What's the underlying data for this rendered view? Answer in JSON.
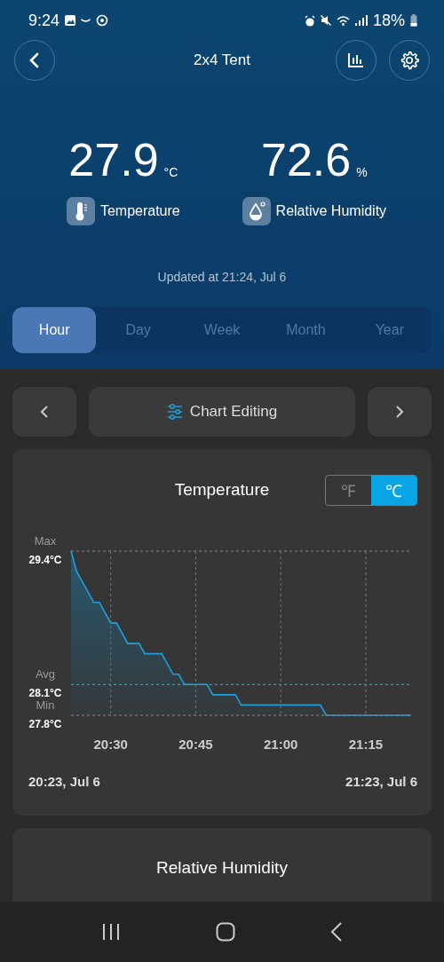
{
  "status_bar": {
    "time": "9:24",
    "battery": "18%"
  },
  "header": {
    "title": "2x4 Tent"
  },
  "readings": [
    {
      "kind": "temperature",
      "value": "27.9",
      "unit": "°C",
      "label": "Temperature"
    },
    {
      "kind": "humidity",
      "value": "72.6",
      "unit": "%",
      "label": "Relative Humidity"
    }
  ],
  "updated": "Updated at 21:24, Jul 6",
  "tabs": [
    {
      "label": "Hour",
      "selected": true
    },
    {
      "label": "Day",
      "selected": false
    },
    {
      "label": "Week",
      "selected": false
    },
    {
      "label": "Month",
      "selected": false
    },
    {
      "label": "Year",
      "selected": false
    }
  ],
  "chart_nav": {
    "label": "Chart Editing"
  },
  "temperature_card": {
    "units": [
      {
        "label": "℉",
        "selected": false
      },
      {
        "label": "℃",
        "selected": true
      }
    ],
    "start_label": "20:23, Jul 6",
    "end_label": "21:23, Jul 6",
    "chart_data": {
      "type": "area",
      "title": "Temperature",
      "categories": [
        null,
        null,
        null,
        null,
        null,
        null,
        null,
        "20:30",
        null,
        null,
        null,
        null,
        null,
        null,
        null,
        null,
        null,
        null,
        null,
        null,
        null,
        null,
        "20:45",
        null,
        null,
        null,
        null,
        null,
        null,
        null,
        null,
        null,
        null,
        null,
        null,
        null,
        null,
        "21:00",
        null,
        null,
        null,
        null,
        null,
        null,
        null,
        null,
        null,
        null,
        null,
        null,
        null,
        null,
        "21:15",
        null,
        null,
        null,
        null,
        null,
        null,
        null,
        null
      ],
      "series": [
        {
          "color": "#1ea0dc",
          "values": [
            29.4,
            29.2,
            29.1,
            29.0,
            28.9,
            28.9,
            28.8,
            28.7,
            28.7,
            28.6,
            28.5,
            28.5,
            28.5,
            28.4,
            28.4,
            28.4,
            28.4,
            28.3,
            28.2,
            28.2,
            28.1,
            28.1,
            28.1,
            28.1,
            28.1,
            28.0,
            28.0,
            28.0,
            28.0,
            28.0,
            27.9,
            27.9,
            27.9,
            27.9,
            27.9,
            27.9,
            27.9,
            27.9,
            27.9,
            27.9,
            27.9,
            27.9,
            27.9,
            27.9,
            27.9,
            27.8,
            27.8,
            27.8,
            27.8,
            27.8,
            27.8,
            27.8,
            27.8,
            27.8,
            27.8,
            27.8,
            27.8,
            27.8,
            27.8,
            27.8,
            27.8
          ]
        }
      ],
      "ylim": [
        27.8,
        29.4
      ],
      "yticks": [
        {
          "value": 29.4,
          "label": "29.4°C"
        },
        {
          "value": 28.1,
          "label": "28.1°C"
        },
        {
          "value": 27.8,
          "label": "27.8°C"
        }
      ],
      "grid": true,
      "ref_lines": [
        {
          "axis": "y",
          "value": 29.4,
          "label": "Max",
          "color": "#8a8a8a"
        },
        {
          "axis": "y",
          "value": 28.1,
          "label": "Avg",
          "color": "#1ea0dc"
        },
        {
          "axis": "y",
          "value": 27.8,
          "label": "Min",
          "color": "#8a8a8a"
        }
      ]
    }
  },
  "humidity_card": {
    "title": "Relative Humidity"
  }
}
